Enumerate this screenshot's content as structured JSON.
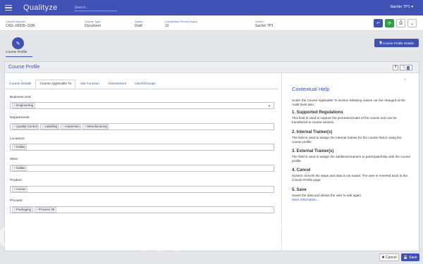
{
  "app": {
    "name": "Qualityze",
    "search_placeholder": "Search...",
    "user": "Sachin TP1 ▾"
  },
  "record": {
    "fields": [
      {
        "label": "Course Number",
        "value": "CRS--00035--SSN"
      },
      {
        "label": "Course Type",
        "value": "Document"
      },
      {
        "label": "Status",
        "value": "Draft"
      },
      {
        "label": "Completion Period (Days)",
        "value": "10"
      },
      {
        "label": "Owner",
        "value": "Sachin TP1"
      }
    ],
    "actions": [
      {
        "name": "undo-icon",
        "glyph": "↶",
        "color": "#3f51b5"
      },
      {
        "name": "refresh-icon",
        "glyph": "⟳",
        "color": "#2e9e47"
      },
      {
        "name": "print-icon",
        "glyph": "⎙",
        "color": "#333333"
      },
      {
        "name": "chevron-down-icon",
        "glyph": "⌄",
        "color": "#333333"
      }
    ]
  },
  "nav": {
    "course_profile": "Course Profile",
    "details_button": "Course Profile Details"
  },
  "panel": {
    "title": "Course Profile",
    "help": "?",
    "attachments_count": "0"
  },
  "tabs": [
    {
      "label": "Course Details",
      "active": false
    },
    {
      "label": "Course Applicable To",
      "active": true
    },
    {
      "label": "Job Function",
      "active": false
    },
    {
      "label": "Assessment",
      "active": false
    },
    {
      "label": "Users/Groups",
      "active": false
    }
  ],
  "form": {
    "business_unit": {
      "label": "Business Unit:",
      "chips": [
        "Engineering"
      ]
    },
    "departments": {
      "label": "Departments:",
      "chips": [
        "Quality Control",
        "Labelling",
        "Inspection",
        "Manufacturing"
      ]
    },
    "locations": {
      "label": "Locations:",
      "chips": [
        "Dallas"
      ]
    },
    "sites": {
      "label": "Sites:",
      "chips": [
        "Dallas"
      ]
    },
    "product": {
      "label": "Product:",
      "chips": [
        "mouse"
      ]
    },
    "process": {
      "label": "Process:",
      "chips": [
        "Packaging",
        "Process 09"
      ]
    }
  },
  "help": {
    "title": "Contextual Help",
    "intro": "Under the Course Applicable To section following values can be changed at the Audit level also.",
    "sections": [
      {
        "title": "1. Supported Regulations",
        "text": "This field is used to capture the procedure/rules of the course and can be transferred to course session."
      },
      {
        "title": "2. Internal Trainer(s)",
        "text": "The field is used to assign the Internal trainee for the course that is using the course profile."
      },
      {
        "title": "3. External Trainer(s)",
        "text": "The field is used to assign the additional trainers to participate/help with the course profile."
      },
      {
        "title": "4. Cancel",
        "text": "System cancels the steps and data is not saved. The user is reverted back to the Course Profile page."
      },
      {
        "title": "5. Save",
        "text": "Saves the data and allows the user to edit again."
      }
    ],
    "more": "More Information..."
  },
  "watermark": "chnologycounter.co",
  "footer": {
    "cancel": "Cancel",
    "save": "Save"
  }
}
